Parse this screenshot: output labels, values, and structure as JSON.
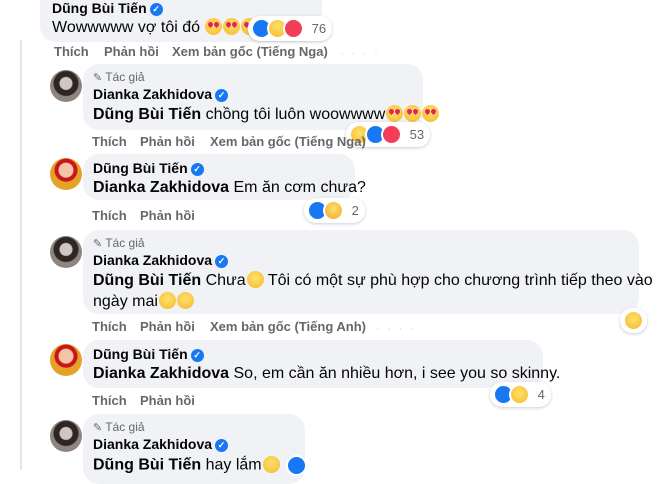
{
  "comments": [
    {
      "author": "Dũng Bùi Tiến",
      "text": "Wowwwww vợ tôi đó",
      "reaction_count": "76",
      "actions": {
        "like": "Thích",
        "reply": "Phản hồi",
        "translate": "Xem bản gốc (Tiếng Nga)"
      }
    },
    {
      "author_tag": "Tác giả",
      "author": "Dianka Zakhidova",
      "mention": "Dũng Bùi Tiến",
      "text": "chồng tôi luôn woowwww",
      "reaction_count": "53",
      "actions": {
        "like": "Thích",
        "reply": "Phản hồi",
        "translate": "Xem bản gốc (Tiếng Nga)"
      }
    },
    {
      "author": "Dũng Bùi Tiến",
      "mention": "Dianka Zakhidova",
      "text": "Em ăn cơm chưa?",
      "reaction_count": "2",
      "actions": {
        "like": "Thích",
        "reply": "Phản hồi"
      }
    },
    {
      "author_tag": "Tác giả",
      "author": "Dianka Zakhidova",
      "mention": "Dũng Bùi Tiến",
      "text_part1": "Chưa",
      "text_part2": "Tôi có một sự phù hợp cho chương trình tiếp theo vào",
      "text_line2": "ngày mai",
      "actions": {
        "like": "Thích",
        "reply": "Phản hồi",
        "translate": "Xem bản gốc (Tiếng Anh)"
      }
    },
    {
      "author": "Dũng Bùi Tiến",
      "mention": "Dianka Zakhidova",
      "text": "So, em cần ăn nhiều hơn, i see you so skinny.",
      "reaction_count": "4",
      "actions": {
        "like": "Thích",
        "reply": "Phản hồi"
      }
    },
    {
      "author_tag": "Tác giả",
      "author": "Dianka Zakhidova",
      "mention": "Dũng Bùi Tiến",
      "text": "hay lắm"
    }
  ],
  "icons": {
    "verified": "verified-badge-icon",
    "pen": "author-pen-icon",
    "heart_eyes": "heart-eyes-emoji-icon",
    "like": "like-reaction-icon",
    "haha": "haha-reaction-icon",
    "love": "love-reaction-icon"
  },
  "colors": {
    "bubble": "#f0f2f5",
    "secondary_text": "#65676b",
    "verified_blue": "#1877f2"
  }
}
